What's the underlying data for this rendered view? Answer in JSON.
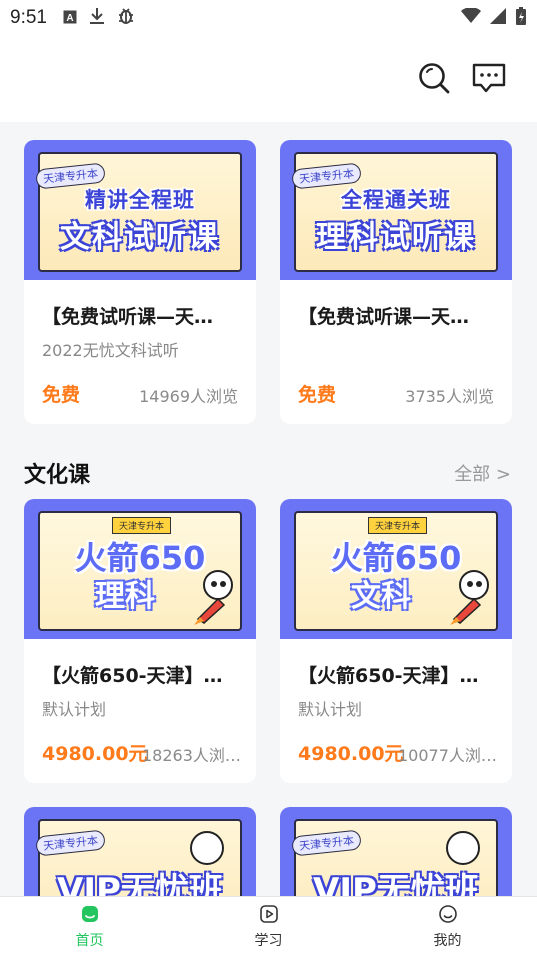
{
  "status_bar": {
    "time": "9:51",
    "icons": [
      "a-box-icon",
      "download-icon",
      "bug-icon",
      "wifi-icon",
      "signal-icon",
      "battery-icon"
    ]
  },
  "header": {
    "icons": [
      "search-icon",
      "message-icon"
    ]
  },
  "featured": [
    {
      "thumb": {
        "tag": "天津专升本",
        "line1": "精讲全程班",
        "line2": "文科试听课"
      },
      "title": "【免费试听课—天…",
      "subtitle": "2022无忧文科试听",
      "price": "免费",
      "views": "14969人浏览"
    },
    {
      "thumb": {
        "tag": "天津专升本",
        "line1": "全程通关班",
        "line2": "理科试听课"
      },
      "title": "【免费试听课—天…",
      "subtitle": "",
      "price": "免费",
      "views": "3735人浏览"
    }
  ],
  "section": {
    "title": "文化课",
    "more": "全部 >"
  },
  "culture": [
    {
      "thumb": {
        "tag": "天津专升本",
        "line1": "火箭650",
        "line2": "理科"
      },
      "title": "【火箭650-天津】…",
      "subtitle": "默认计划",
      "price": "4980.00元",
      "views": "18263人浏…"
    },
    {
      "thumb": {
        "tag": "天津专升本",
        "line1": "火箭650",
        "line2": "文科"
      },
      "title": "【火箭650-天津】…",
      "subtitle": "默认计划",
      "price": "4980.00元",
      "views": "10077人浏…"
    }
  ],
  "vip": [
    {
      "thumb": {
        "tag": "天津专升本",
        "line1": "VIP无忧班"
      }
    },
    {
      "thumb": {
        "tag": "天津专升本",
        "line1": "VIP无忧班"
      }
    }
  ],
  "tabbar": [
    {
      "label": "首页",
      "icon": "home-icon",
      "active": true
    },
    {
      "label": "学习",
      "icon": "play-icon",
      "active": false
    },
    {
      "label": "我的",
      "icon": "profile-icon",
      "active": false
    }
  ],
  "colors": {
    "accent_green": "#22c55e",
    "price_orange": "#ff7a1a",
    "thumb_blue": "#6b74f4"
  }
}
